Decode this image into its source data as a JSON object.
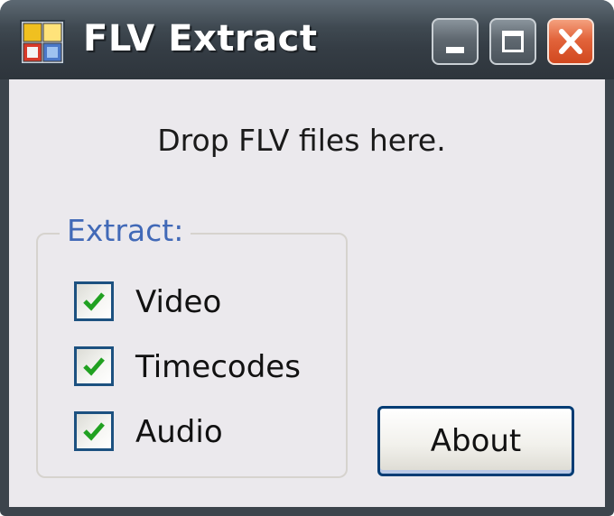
{
  "window": {
    "title": "FLV Extract",
    "icon": "app-grid-icon"
  },
  "titlebar_buttons": {
    "minimize_icon": "minimize-icon",
    "maximize_icon": "maximize-icon",
    "close_icon": "close-icon"
  },
  "main": {
    "drop_hint": "Drop FLV files here."
  },
  "extract_group": {
    "legend": "Extract:",
    "options": [
      {
        "label": "Video",
        "checked": true
      },
      {
        "label": "Timecodes",
        "checked": true
      },
      {
        "label": "Audio",
        "checked": true
      }
    ]
  },
  "about_button": {
    "label": "About"
  },
  "colors": {
    "titlebar": "#3f4951",
    "client_background": "#ebe9ed",
    "legend_text": "#4169b7",
    "checkmark": "#21a121",
    "close_button": "#e2643b"
  }
}
